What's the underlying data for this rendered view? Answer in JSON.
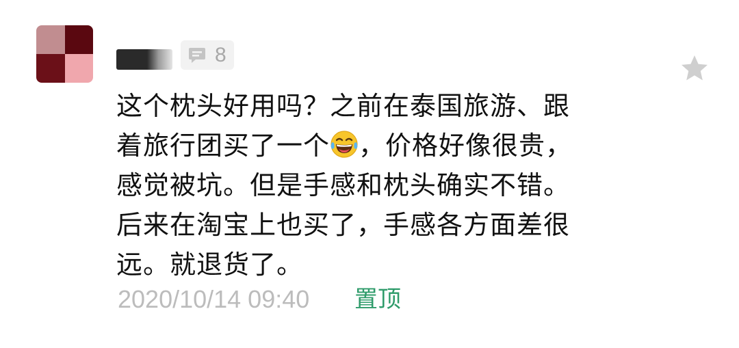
{
  "comment": {
    "reply_count": "8",
    "lines": [
      "这个枕头好用吗？之前在泰国旅游、跟",
      "着旅行团买了一个",
      "，价格好像很贵，",
      "感觉被坑。但是手感和枕头确实不错。",
      "后来在淘宝上也买了，手感各方面差很",
      "远。就退货了。"
    ],
    "timestamp": "2020/10/14 09:40",
    "pin_label": "置顶"
  },
  "icons": {
    "reply": "comment-bubble-icon",
    "favorite": "star-icon",
    "emoji": "laughing-tears-emoji-icon"
  },
  "colors": {
    "pin_green": "#2e9b6a",
    "meta_gray": "#bcbcbc",
    "text": "#111111",
    "badge_bg": "#f2f2f2"
  }
}
